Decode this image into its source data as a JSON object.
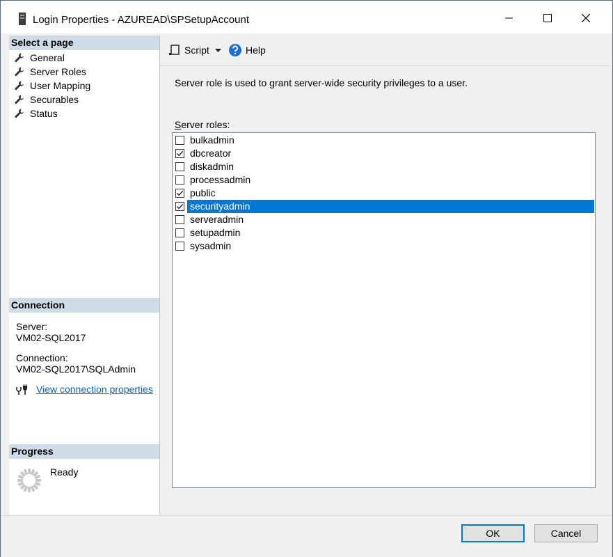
{
  "window": {
    "title": "Login Properties - AZUREAD\\SPSetupAccount",
    "minimize_icon": "minimize-icon",
    "maximize_icon": "maximize-icon",
    "close_icon": "close-icon"
  },
  "sidebar": {
    "select_page_header": "Select a page",
    "pages": [
      {
        "label": "General",
        "icon": "wrench-icon"
      },
      {
        "label": "Server Roles",
        "icon": "wrench-icon"
      },
      {
        "label": "User Mapping",
        "icon": "wrench-icon"
      },
      {
        "label": "Securables",
        "icon": "wrench-icon"
      },
      {
        "label": "Status",
        "icon": "wrench-icon"
      }
    ],
    "connection_header": "Connection",
    "server_label": "Server:",
    "server_value": "VM02-SQL2017",
    "connection_label": "Connection:",
    "connection_value": "VM02-SQL2017\\SQLAdmin",
    "view_connection_link": "View connection properties",
    "progress_header": "Progress",
    "progress_status": "Ready"
  },
  "toolbar": {
    "script_label": "Script",
    "help_label": "Help"
  },
  "main": {
    "description": "Server role is used to grant server-wide security privileges to a user.",
    "roles_label_accel": "S",
    "roles_label_rest": "erver roles:",
    "roles": [
      {
        "name": "bulkadmin",
        "checked": false
      },
      {
        "name": "dbcreator",
        "checked": true
      },
      {
        "name": "diskadmin",
        "checked": false
      },
      {
        "name": "processadmin",
        "checked": false
      },
      {
        "name": "public",
        "checked": true
      },
      {
        "name": "securityadmin",
        "checked": true,
        "selected": true
      },
      {
        "name": "serveradmin",
        "checked": false
      },
      {
        "name": "setupadmin",
        "checked": false
      },
      {
        "name": "sysadmin",
        "checked": false
      }
    ]
  },
  "buttons": {
    "ok": "OK",
    "cancel": "Cancel"
  },
  "colors": {
    "selection": "#0078d7",
    "header_band": "#cfdbe7",
    "link": "#0066cc"
  }
}
